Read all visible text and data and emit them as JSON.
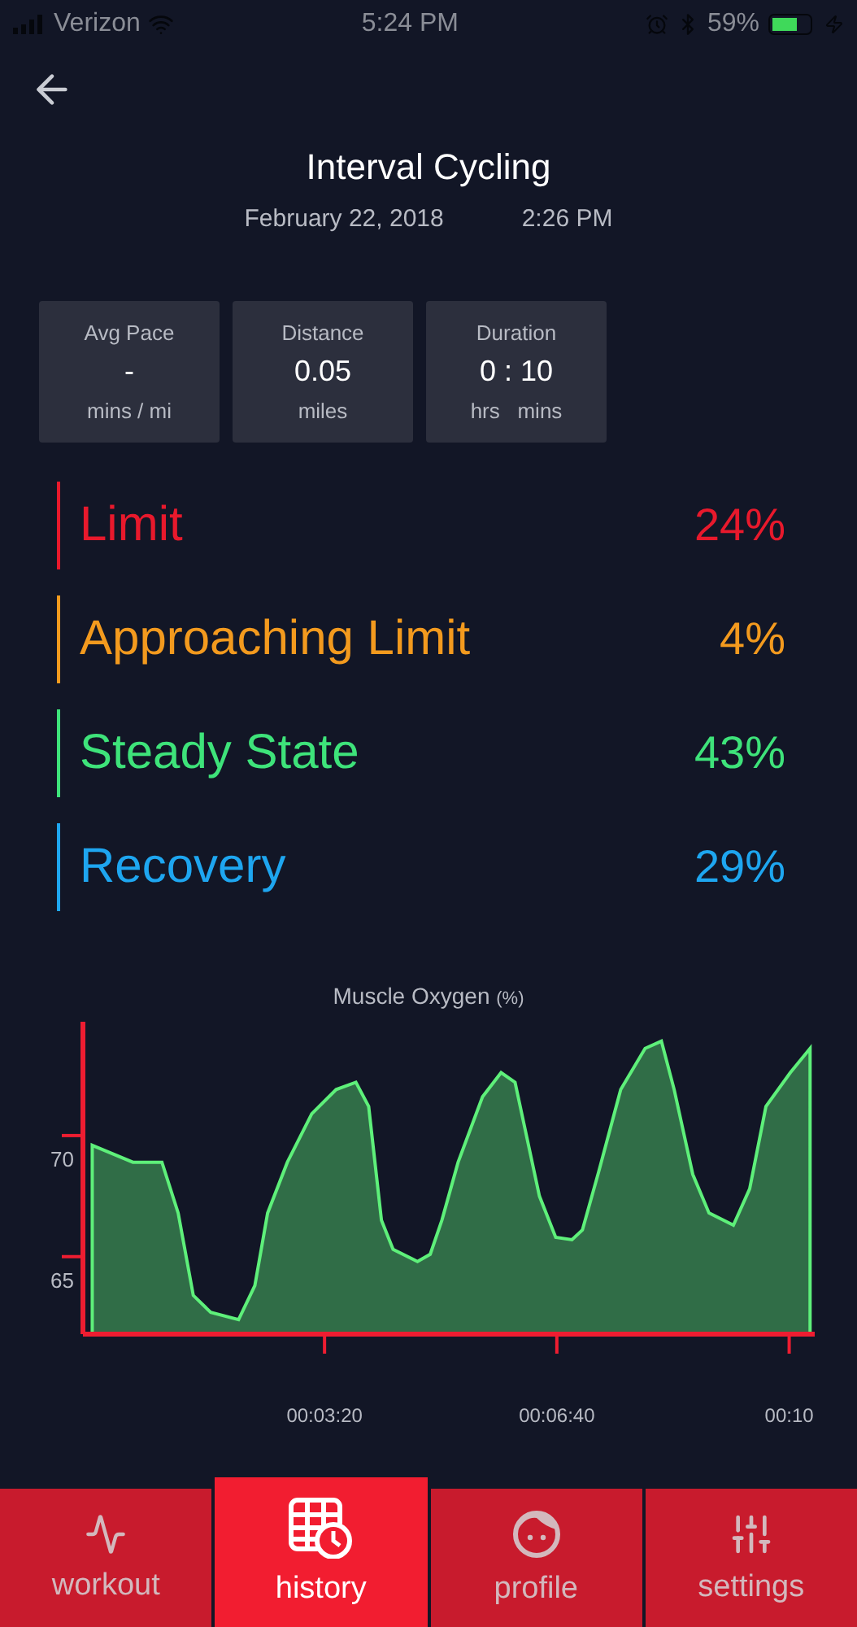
{
  "status_bar": {
    "carrier": "Verizon",
    "time": "5:24 PM",
    "battery": "59%"
  },
  "header": {
    "title": "Interval Cycling",
    "date": "February 22, 2018",
    "time": "2:26 PM"
  },
  "stats": [
    {
      "label": "Avg Pace",
      "value": "-",
      "unit": "mins / mi"
    },
    {
      "label": "Distance",
      "value": "0.05",
      "unit": "miles"
    },
    {
      "label": "Duration",
      "value": "0 : 10",
      "unit": "hrs   mins"
    }
  ],
  "zones": [
    {
      "label": "Limit",
      "value": "24%",
      "color": "#e8192c"
    },
    {
      "label": "Approaching Limit",
      "value": "4%",
      "color": "#f39a1e"
    },
    {
      "label": "Steady State",
      "value": "43%",
      "color": "#3ee37a"
    },
    {
      "label": "Recovery",
      "value": "29%",
      "color": "#1ea6f0"
    }
  ],
  "chart": {
    "unit": "(%)",
    "chart_data": {
      "type": "area",
      "title": "Muscle Oxygen",
      "x": [
        0,
        35,
        60,
        74,
        87,
        102,
        126,
        140,
        151,
        168,
        189,
        210,
        227,
        238,
        249,
        259,
        280,
        291,
        301,
        315,
        336,
        352,
        364,
        385,
        399,
        413,
        422,
        436,
        455,
        476,
        490,
        501,
        517,
        531,
        552,
        566,
        580,
        601,
        618
      ],
      "series": [
        {
          "color": "#5ef07a",
          "values": [
            69.6,
            68.9,
            68.9,
            66.8,
            63.4,
            62.7,
            62.4,
            63.8,
            66.8,
            68.9,
            70.9,
            71.9,
            72.2,
            71.2,
            66.5,
            65.3,
            64.8,
            65.1,
            66.5,
            68.9,
            71.6,
            72.6,
            72.2,
            67.5,
            65.8,
            65.7,
            66.1,
            68.5,
            71.9,
            73.6,
            73.9,
            71.9,
            68.4,
            66.8,
            66.3,
            67.8,
            71.2,
            72.6,
            73.6
          ]
        }
      ],
      "xlim": [
        -8,
        622
      ],
      "ylim": [
        61.8,
        74.7
      ],
      "yticks": [
        65,
        70
      ],
      "xticks": [
        {
          "value": 200,
          "label": "00:03:20"
        },
        {
          "value": 400,
          "label": "00:06:40"
        },
        {
          "value": 600,
          "label": "00:10"
        }
      ]
    }
  },
  "tabs": [
    {
      "label": "workout",
      "selected": false
    },
    {
      "label": "history",
      "selected": true
    },
    {
      "label": "profile",
      "selected": false
    },
    {
      "label": "settings",
      "selected": false
    }
  ]
}
